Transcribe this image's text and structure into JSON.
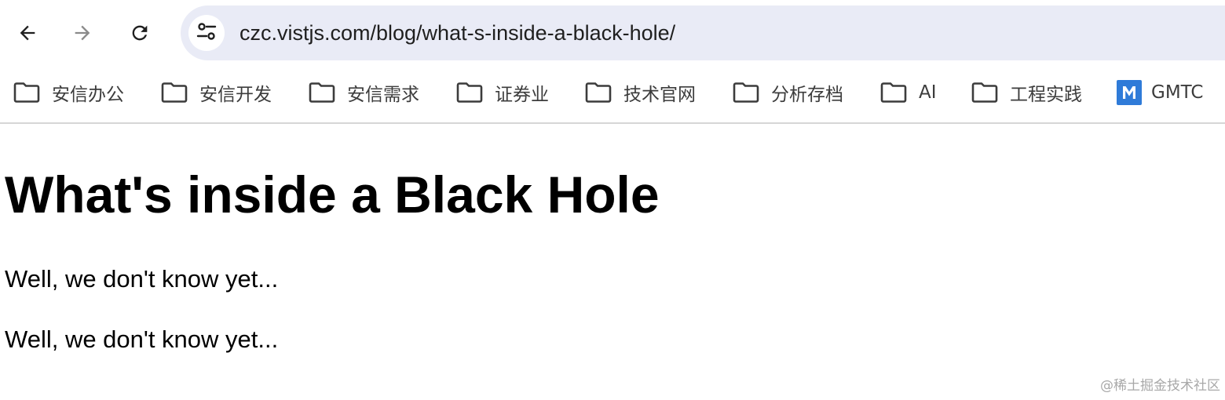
{
  "browser": {
    "url": "czc.vistjs.com/blog/what-s-inside-a-black-hole/",
    "icons": {
      "back": "arrow-left-icon",
      "forward": "arrow-right-icon",
      "reload": "reload-icon",
      "site_info": "tune-icon"
    }
  },
  "bookmarks": [
    {
      "label": "安信办公",
      "icon": "folder-icon"
    },
    {
      "label": "安信开发",
      "icon": "folder-icon"
    },
    {
      "label": "安信需求",
      "icon": "folder-icon"
    },
    {
      "label": "证券业",
      "icon": "folder-icon"
    },
    {
      "label": "技术官网",
      "icon": "folder-icon"
    },
    {
      "label": "分析存档",
      "icon": "folder-icon"
    },
    {
      "label": "AI",
      "icon": "folder-icon"
    },
    {
      "label": "工程实践",
      "icon": "folder-icon"
    },
    {
      "label": "GMTC",
      "icon": "gmtc-logo-icon"
    }
  ],
  "page": {
    "title": "What's inside a Black Hole",
    "paragraphs": [
      "Well, we don't know yet...",
      "Well, we don't know yet..."
    ]
  },
  "watermark": "@稀土掘金技术社区",
  "colors": {
    "omnibox_bg": "#e9ebf6",
    "gmtc_brand": "#2f7bd8"
  }
}
